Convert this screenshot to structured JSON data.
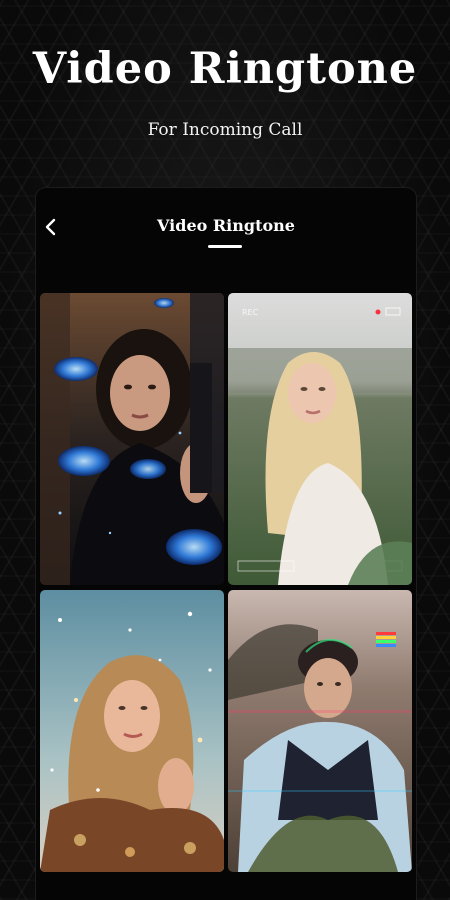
{
  "header": {
    "title": "Video Ringtone",
    "subtitle": "For Incoming Call"
  },
  "screen": {
    "title": "Video Ringtone"
  },
  "thumbnails": [
    {
      "name": "thumbnail-butterfly-girl"
    },
    {
      "name": "thumbnail-blonde-girl"
    },
    {
      "name": "thumbnail-sparkle-girl"
    },
    {
      "name": "thumbnail-glitch-boy"
    }
  ],
  "colors": {
    "background": "#0a0a0a",
    "text": "#ffffff",
    "panel": "#050505"
  }
}
